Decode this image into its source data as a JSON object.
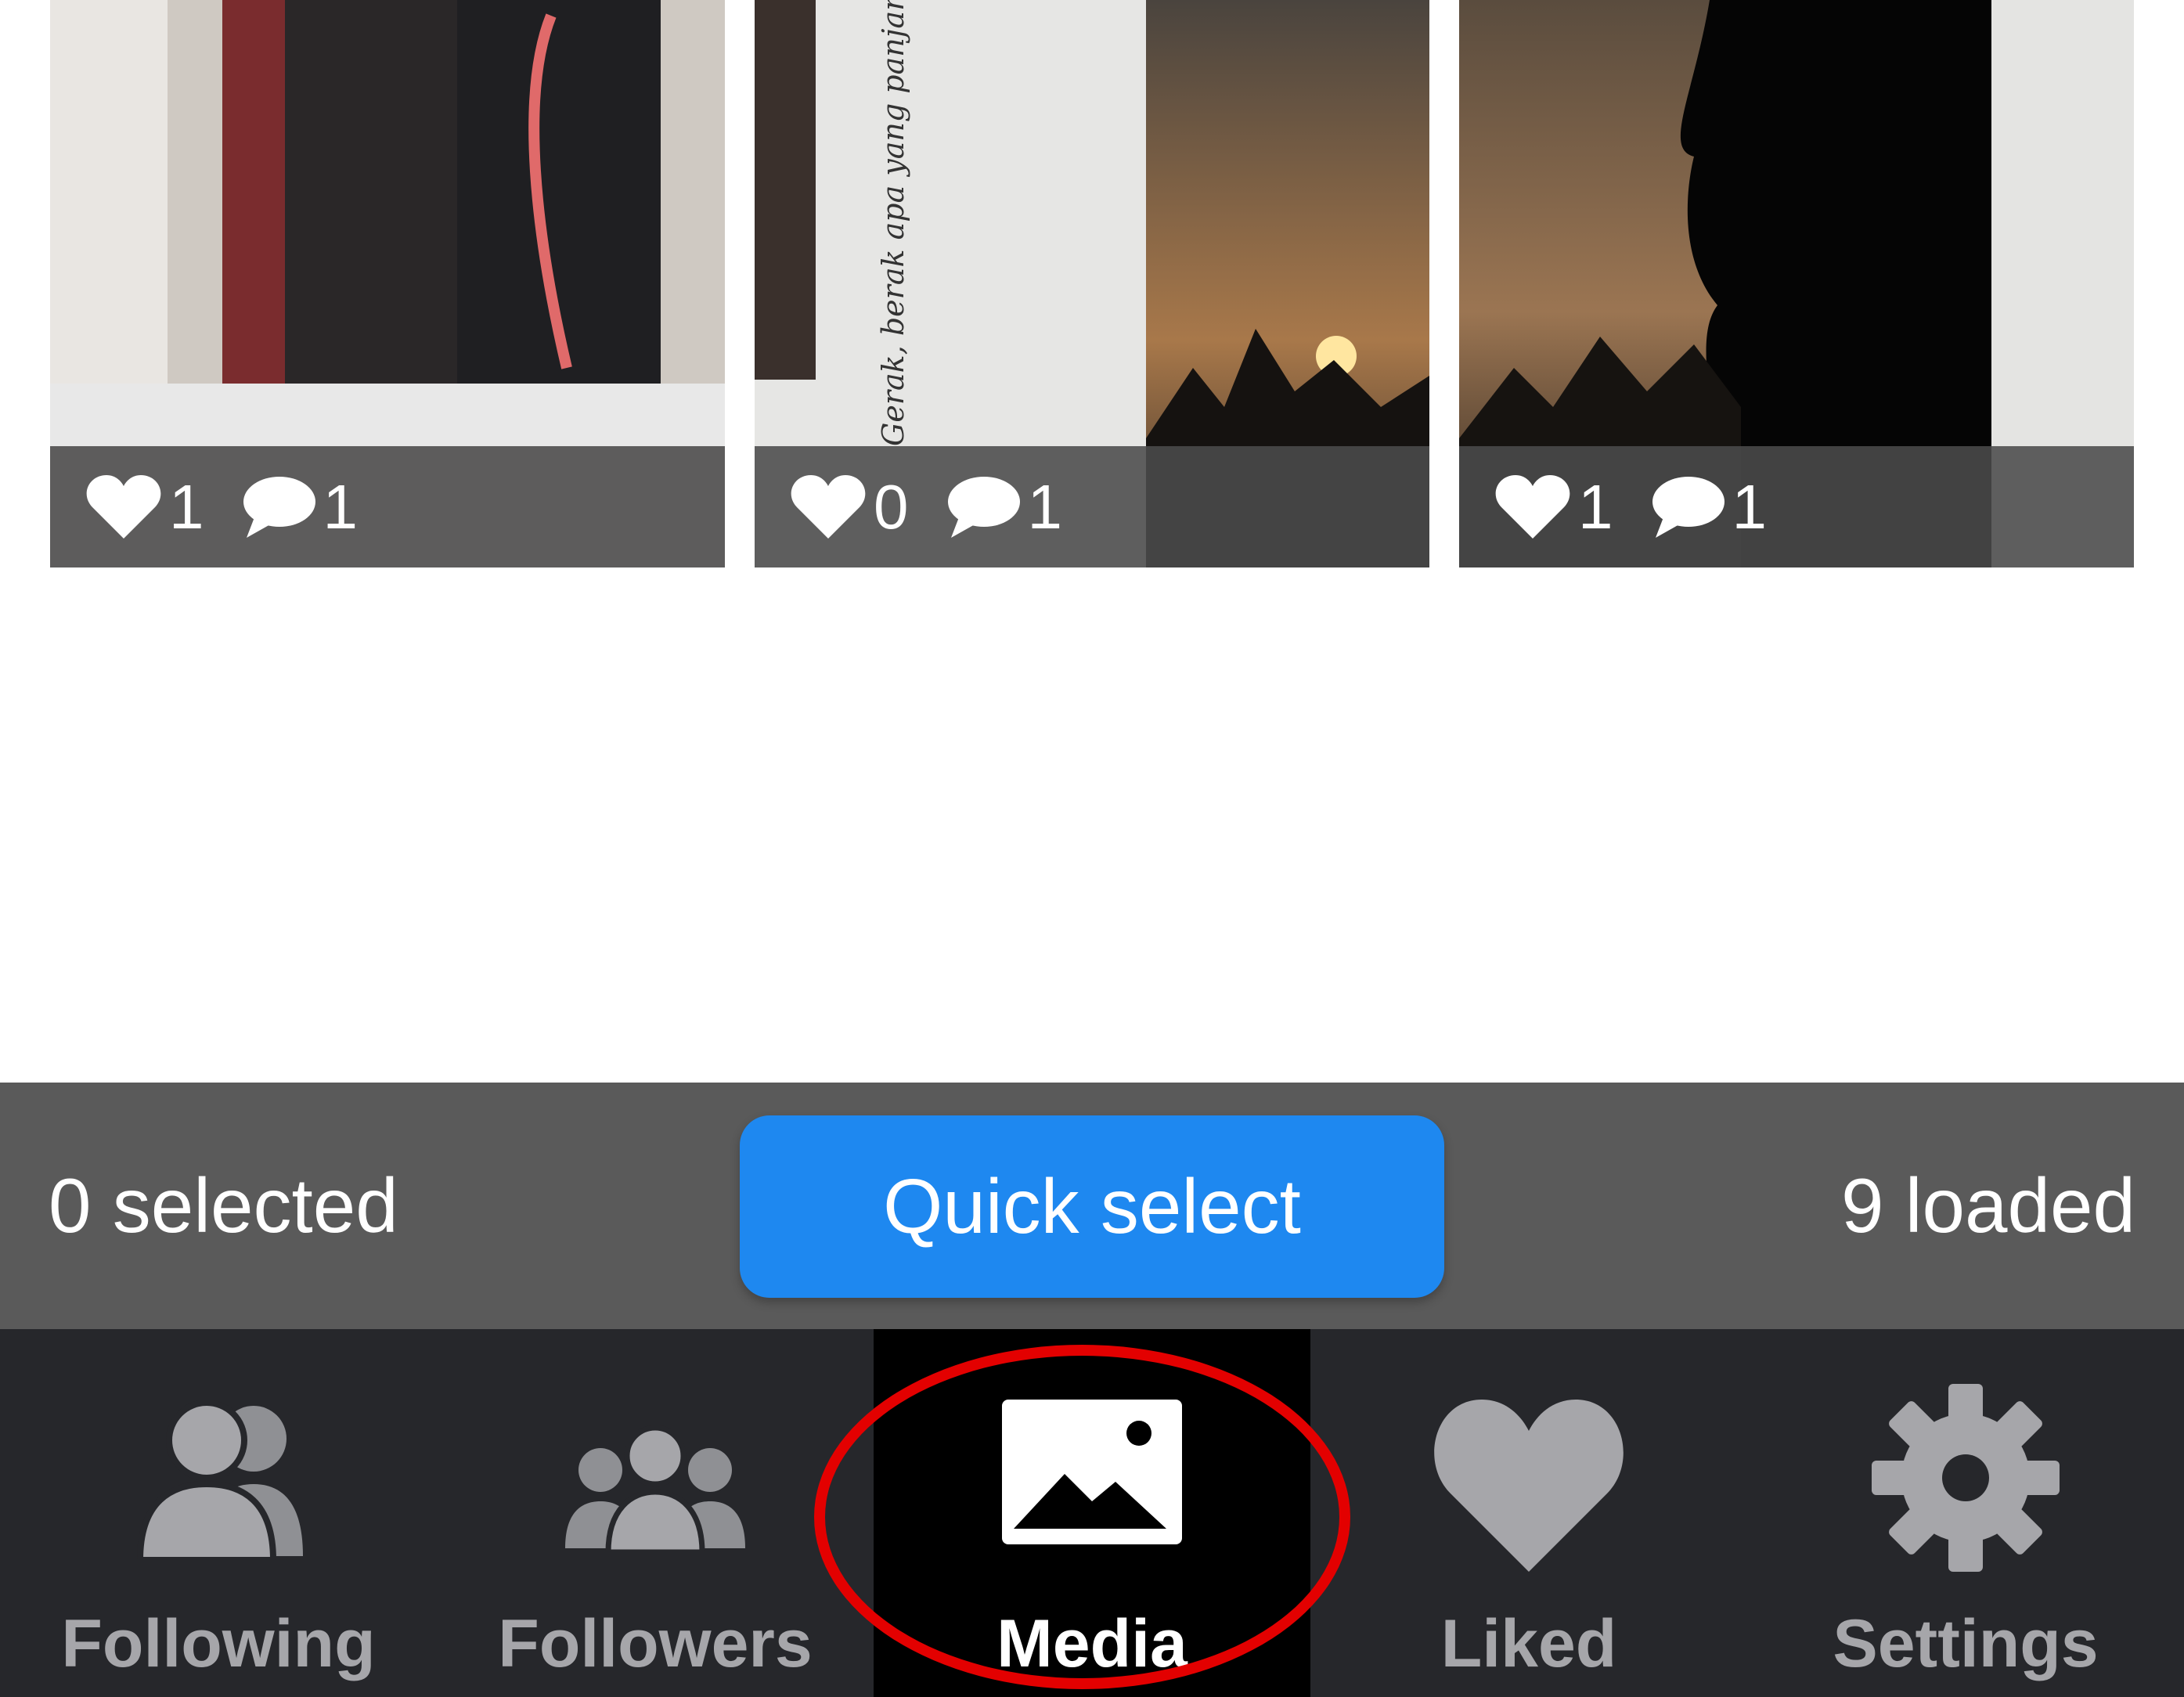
{
  "posts": [
    {
      "likes": "1",
      "comments": "1"
    },
    {
      "likes": "0",
      "comments": "1"
    },
    {
      "likes": "1",
      "comments": "1"
    }
  ],
  "post_caption_text": "Gerak, berak apa yang panjang? Yak betul, berak tambang",
  "selection_bar": {
    "selected_text": "0 selected",
    "quick_select_label": "Quick select",
    "loaded_text": "9 loaded"
  },
  "nav": [
    {
      "label": "Following",
      "icon": "following-icon"
    },
    {
      "label": "Followers",
      "icon": "followers-icon"
    },
    {
      "label": "Media",
      "icon": "media-icon"
    },
    {
      "label": "Liked",
      "icon": "heart-icon"
    },
    {
      "label": "Settings",
      "icon": "gear-icon"
    }
  ],
  "active_tab": "Media",
  "colors": {
    "accent": "#1e88f0",
    "highlight": "#e30000",
    "tabbar": "#26272b",
    "toolbar": "#5a5a5a"
  }
}
